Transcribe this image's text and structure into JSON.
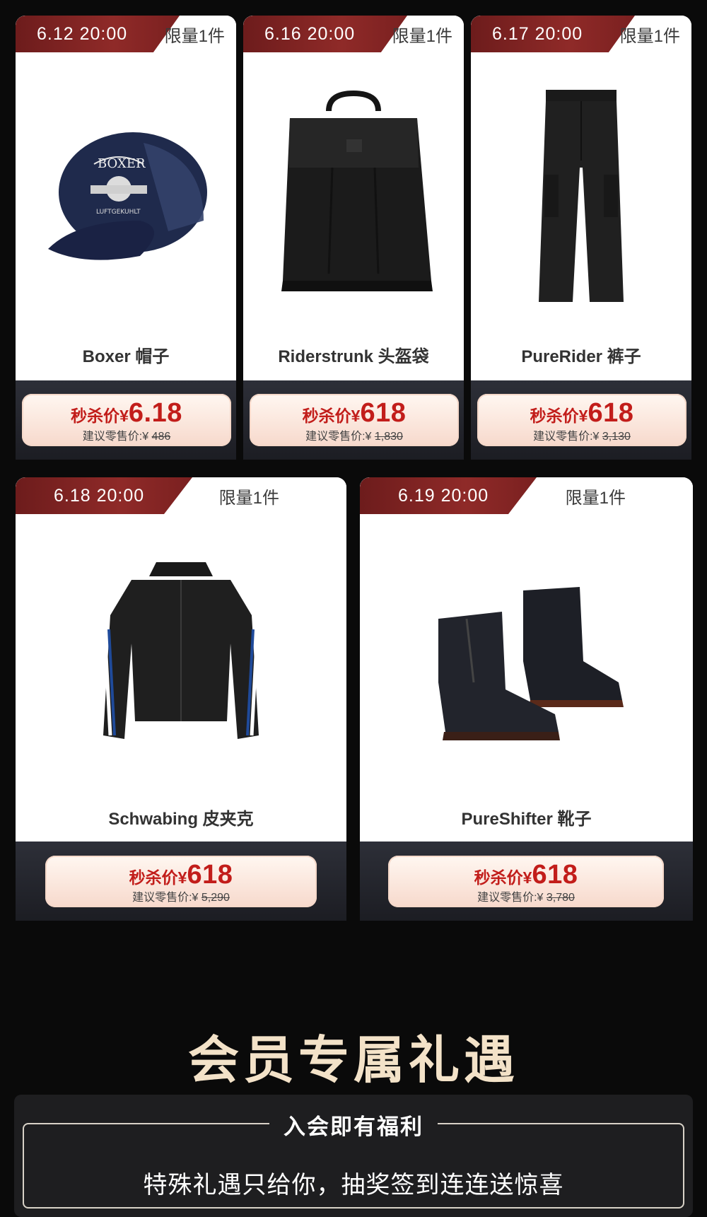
{
  "products": [
    {
      "time": "6.12 20:00",
      "limit": "限量1件",
      "name": "Boxer 帽子",
      "price_label": "秒杀价",
      "currency": "¥",
      "price": "6.18",
      "msrp_label": "建议零售价:",
      "msrp_currency": "¥",
      "msrp": "486",
      "icon": "cap-image"
    },
    {
      "time": "6.16 20:00",
      "limit": "限量1件",
      "name": "Riderstrunk 头盔袋",
      "price_label": "秒杀价",
      "currency": "¥",
      "price": "618",
      "msrp_label": "建议零售价:",
      "msrp_currency": "¥",
      "msrp": "1,830",
      "icon": "bag-image"
    },
    {
      "time": "6.17 20:00",
      "limit": "限量1件",
      "name": "PureRider 裤子",
      "price_label": "秒杀价",
      "currency": "¥",
      "price": "618",
      "msrp_label": "建议零售价:",
      "msrp_currency": "¥",
      "msrp": "3,130",
      "icon": "pants-image"
    },
    {
      "time": "6.18 20:00",
      "limit": "限量1件",
      "name": "Schwabing 皮夹克",
      "price_label": "秒杀价",
      "currency": "¥",
      "price": "618",
      "msrp_label": "建议零售价:",
      "msrp_currency": "¥",
      "msrp": "5,290",
      "icon": "jacket-image"
    },
    {
      "time": "6.19 20:00",
      "limit": "限量1件",
      "name": "PureShifter 靴子",
      "price_label": "秒杀价",
      "currency": "¥",
      "price": "618",
      "msrp_label": "建议零售价:",
      "msrp_currency": "¥",
      "msrp": "3,780",
      "icon": "boots-image"
    }
  ],
  "member": {
    "title": "会员专属礼遇",
    "subtitle": "入会即有福利",
    "description": "特殊礼遇只给你，抽奖签到连连送惊喜"
  },
  "colors": {
    "accent": "#c21d1a",
    "tag": "#7a2020",
    "background": "#0a0a0a",
    "title": "#f3e2c8"
  }
}
